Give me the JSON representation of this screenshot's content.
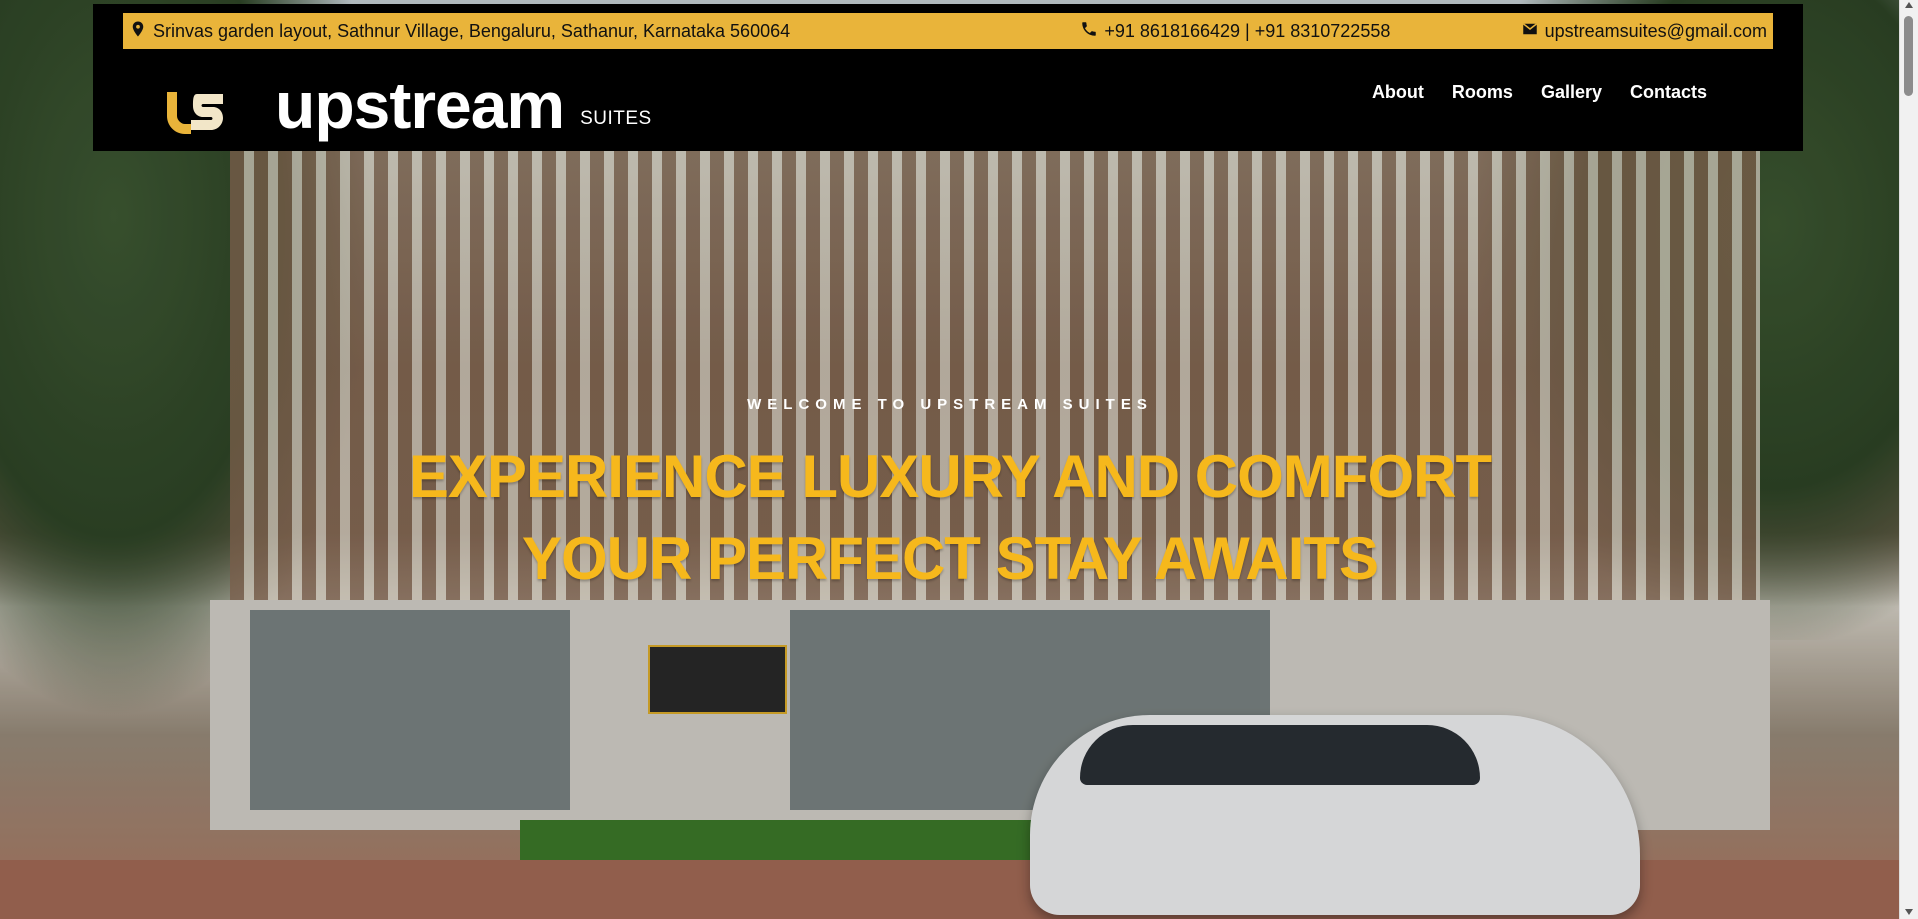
{
  "topbar": {
    "address": "Srinvas garden layout, Sathnur Village, Bengaluru, Sathanur, Karnataka 560064",
    "phone": "+91 8618166429 | +91 8310722558",
    "email": "upstreamsuites@gmail.com",
    "icons": {
      "address": "map-pin-icon",
      "phone": "phone-icon",
      "email": "mail-icon"
    }
  },
  "brand": {
    "name": "upstream",
    "suffix": "SUITES"
  },
  "nav": {
    "items": [
      "About",
      "Rooms",
      "Gallery",
      "Contacts"
    ]
  },
  "hero": {
    "welcome": "WELCOME TO UPSTREAM SUITES",
    "line1": "EXPERIENCE LUXURY AND COMFORT",
    "line2": "YOUR PERFECT STAY AWAITS"
  },
  "colors": {
    "accent": "#f6b81c",
    "bar": "#e9b43a",
    "header": "#000000"
  }
}
